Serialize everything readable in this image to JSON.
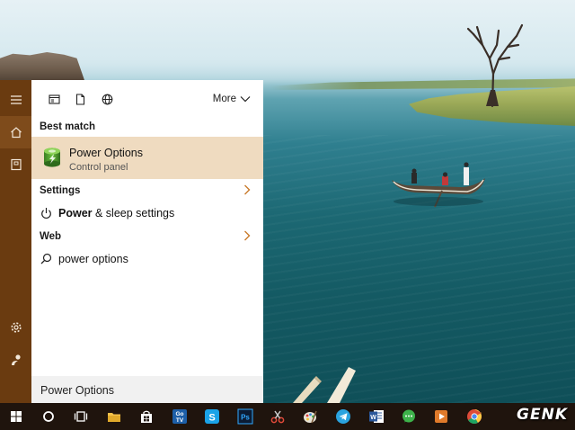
{
  "start_menu": {
    "rail": {
      "items": [
        {
          "icon": "hamburger-menu-icon"
        },
        {
          "icon": "home-icon"
        },
        {
          "icon": "notebook-icon"
        },
        {
          "icon": "settings-gear-icon"
        },
        {
          "icon": "feedback-icon"
        }
      ]
    },
    "filters": {
      "items": [
        {
          "icon": "apps-filter-icon"
        },
        {
          "icon": "documents-filter-icon"
        },
        {
          "icon": "web-globe-icon"
        }
      ],
      "more_label": "More"
    },
    "best_match": {
      "heading": "Best match",
      "title": "Power Options",
      "subtitle": "Control panel",
      "icon": "power-options-battery-icon"
    },
    "settings": {
      "heading": "Settings",
      "result_bold": "Power",
      "result_rest": " & sleep settings",
      "icon": "power-icon"
    },
    "web": {
      "heading": "Web",
      "result": "power options",
      "icon": "search-icon"
    },
    "search_box": {
      "value": "Power Options"
    }
  },
  "taskbar": {
    "items": [
      {
        "icon": "windows-start-icon"
      },
      {
        "icon": "cortana-circle-icon"
      },
      {
        "icon": "task-view-icon"
      },
      {
        "icon": "file-explorer-icon"
      },
      {
        "icon": "windows-store-icon"
      },
      {
        "icon": "gotv-app-icon",
        "label": "GoTV"
      },
      {
        "icon": "skype-icon"
      },
      {
        "icon": "photoshop-icon",
        "label": "Ps"
      },
      {
        "icon": "snipping-tool-icon"
      },
      {
        "icon": "paint-icon"
      },
      {
        "icon": "telegram-icon"
      },
      {
        "icon": "word-icon",
        "label": "W"
      },
      {
        "icon": "chat-app-icon"
      },
      {
        "icon": "media-player-icon"
      },
      {
        "icon": "chrome-icon"
      }
    ]
  },
  "watermark": "GENK",
  "colors": {
    "accent_rail": "#6a3b10",
    "highlight": "#efdbc0",
    "taskbar": "#1f140d",
    "chevron": "#c87a2a"
  }
}
